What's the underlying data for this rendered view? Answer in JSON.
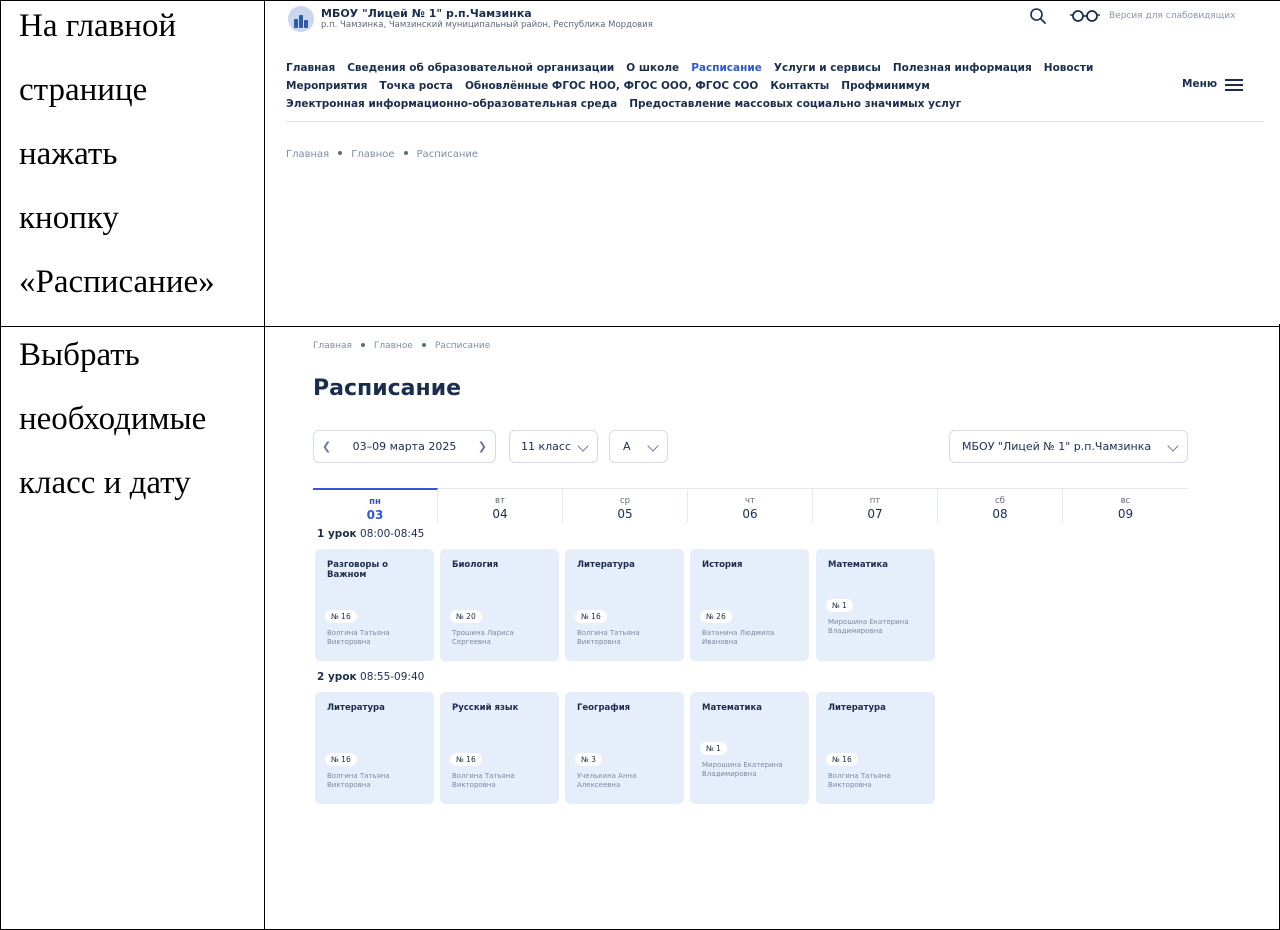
{
  "steps": [
    {
      "lines": [
        "На главной",
        "странице",
        "нажать",
        "кнопку",
        "«Расписание»"
      ]
    },
    {
      "lines": [
        "Выбрать",
        "необходимые",
        "класс и дату"
      ]
    }
  ],
  "header": {
    "org_name": "МБОУ \"Лицей № 1\" р.п.Чамзинка",
    "org_address": "р.п. Чамзинка, Чамзинский муниципальный район, Республика Мордовия",
    "version_label": "Версия для слабовидящих",
    "menu_label": "Меню",
    "nav_rows": [
      [
        "Главная",
        "Сведения об образовательной организации",
        "О школе",
        "Расписание",
        "Услуги и сервисы",
        "Полезная информация",
        "Новости"
      ],
      [
        "Мероприятия",
        "Точка роста",
        "Обновлённые ФГОС НОО, ФГОС ООО, ФГОС СОО",
        "Контакты",
        "Профминимум"
      ],
      [
        "Электронная информационно-образовательная среда",
        "Предоставление массовых социально значимых услуг"
      ]
    ],
    "active_nav": "Расписание"
  },
  "breadcrumb": [
    "Главная",
    "Главное",
    "Расписание"
  ],
  "schedule": {
    "title": "Расписание",
    "week": "03–09 марта 2025",
    "class": "11 класс",
    "letter": "А",
    "school": "МБОУ \"Лицей № 1\" р.п.Чамзинка",
    "days": [
      {
        "name": "пн",
        "num": "03",
        "active": true
      },
      {
        "name": "вт",
        "num": "04",
        "active": false
      },
      {
        "name": "ср",
        "num": "05",
        "active": false
      },
      {
        "name": "чт",
        "num": "06",
        "active": false
      },
      {
        "name": "пт",
        "num": "07",
        "active": false
      },
      {
        "name": "сб",
        "num": "08",
        "active": false
      },
      {
        "name": "вс",
        "num": "09",
        "active": false
      }
    ],
    "lessons": [
      {
        "label": "1 урок",
        "time": "08:00-08:45",
        "cards": [
          {
            "subject": "Разговоры о Важном",
            "room": "№ 16",
            "teacher": "Волгина Татьяна Викторовна"
          },
          {
            "subject": "Биология",
            "room": "№ 20",
            "teacher": "Трошина Лариса Сергеевна"
          },
          {
            "subject": "Литература",
            "room": "№ 16",
            "teacher": "Волгина Татьяна Викторовна"
          },
          {
            "subject": "История",
            "room": "№ 26",
            "teacher": "Ватанина Людмила Ивановна"
          },
          {
            "subject": "Математика",
            "room": "№ 1",
            "teacher": "Мирошина Екатерина Владимировна"
          }
        ]
      },
      {
        "label": "2 урок",
        "time": "08:55-09:40",
        "cards": [
          {
            "subject": "Литература",
            "room": "№ 16",
            "teacher": "Волгина Татьяна Викторовна"
          },
          {
            "subject": "Русский язык",
            "room": "№ 16",
            "teacher": "Волгина Татьяна Викторовна"
          },
          {
            "subject": "География",
            "room": "№ 3",
            "teacher": "Учелькина Анна Алексеевна"
          },
          {
            "subject": "Математика",
            "room": "№ 1",
            "teacher": "Мирошина Екатерина Владимировна"
          },
          {
            "subject": "Литература",
            "room": "№ 16",
            "teacher": "Волгина Татьяна Викторовна"
          }
        ]
      }
    ]
  }
}
